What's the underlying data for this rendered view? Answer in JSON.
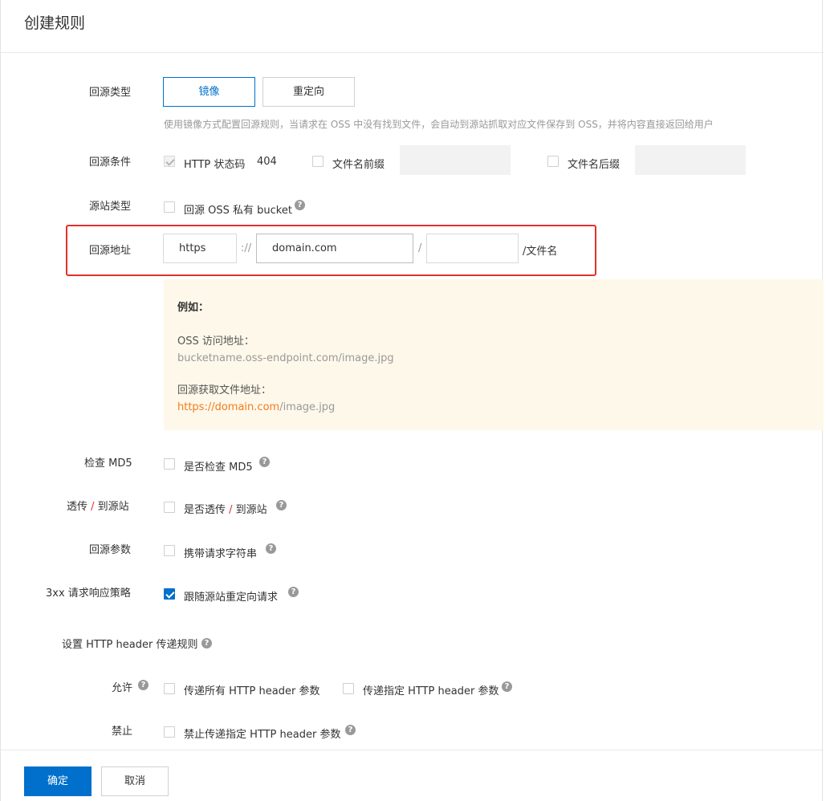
{
  "header": {
    "title": "创建规则"
  },
  "origin_type": {
    "label": "回源类型",
    "options": [
      "镜像",
      "重定向"
    ],
    "selected": "镜像",
    "description": "使用镜像方式配置回源规则，当请求在 OSS 中没有找到文件，会自动到源站抓取对应文件保存到 OSS，并将内容直接返回给用户"
  },
  "origin_condition": {
    "label": "回源条件",
    "http_status_label": "HTTP 状态码",
    "http_status_value": "404",
    "prefix_label": "文件名前缀",
    "prefix_value": "",
    "suffix_label": "文件名后缀",
    "suffix_value": ""
  },
  "source_type": {
    "label": "源站类型",
    "private_bucket_label": "回源 OSS 私有 bucket"
  },
  "origin_address": {
    "label": "回源地址",
    "protocol_value": "https",
    "sep_scheme": "://",
    "domain_value": "domain.com",
    "sep_slash": "/",
    "path_value": "",
    "filename_suffix": "/文件名"
  },
  "example": {
    "title": "例如：",
    "oss_label": "OSS 访问地址：",
    "oss_url": "bucketname.oss-endpoint.com/image.jpg",
    "origin_label": "回源获取文件地址：",
    "origin_url_highlight": "https://domain.com",
    "origin_url_rest": "/image.jpg"
  },
  "check_md5": {
    "label": "检查 MD5",
    "option": "是否检查 MD5"
  },
  "passthrough": {
    "label_a": "透传",
    "label_sep": " / ",
    "label_b": "到源站",
    "option_a": "是否透传",
    "option_sep": " / ",
    "option_b": "到源站"
  },
  "origin_params": {
    "label": "回源参数",
    "option": "携带请求字符串"
  },
  "redirect_policy": {
    "label": "3xx 请求响应策略",
    "option": "跟随源站重定向请求",
    "checked": true
  },
  "header_rules": {
    "title": "设置 HTTP header 传递规则",
    "allow_label": "允许",
    "allow_all": "传递所有 HTTP header 参数",
    "allow_specific": "传递指定 HTTP header 参数",
    "deny_label": "禁止",
    "deny_specific": "禁止传递指定 HTTP header 参数"
  },
  "footer": {
    "confirm": "确定",
    "cancel": "取消"
  },
  "colors": {
    "primary": "#0070cc",
    "highlight_border": "#e0312c",
    "example_bg": "#fdf8e9",
    "link_orange": "#f37b1d"
  },
  "icons": {
    "help": "question-circle-icon",
    "check": "checkmark-icon"
  }
}
